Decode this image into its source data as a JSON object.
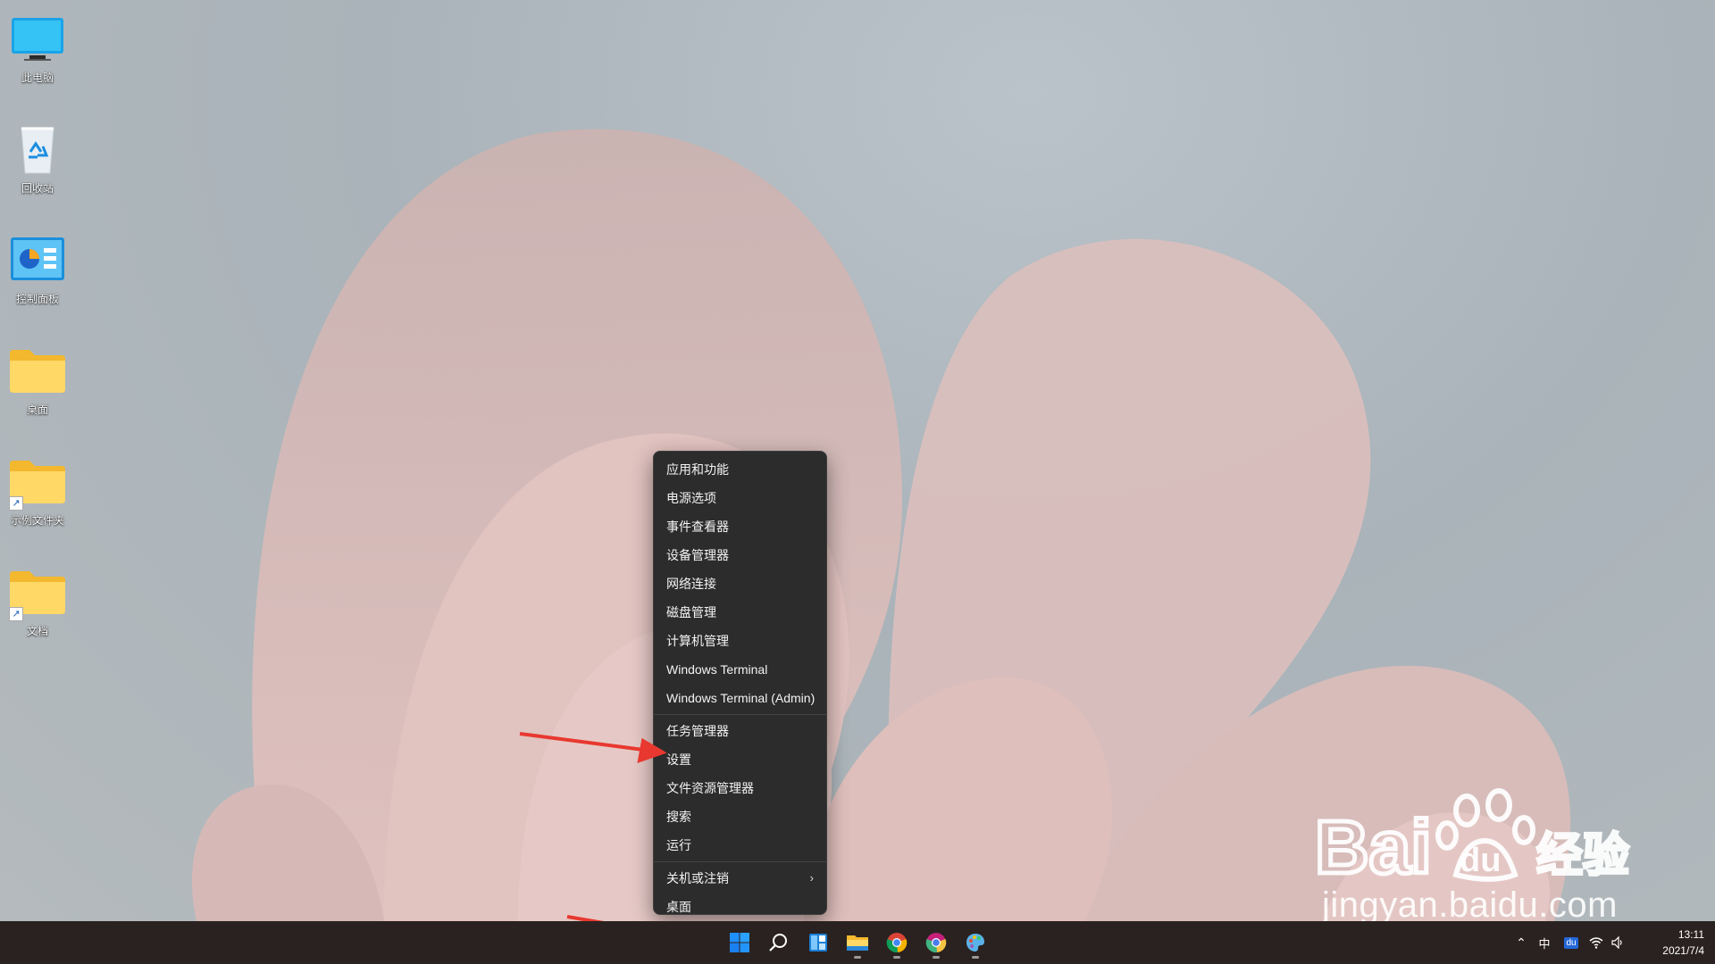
{
  "desktop": {
    "icons": [
      {
        "label": "此电脑",
        "icon": "computer-icon"
      },
      {
        "label": "回收站",
        "icon": "recycle-bin-icon"
      },
      {
        "label": "控制面板",
        "icon": "control-panel-icon"
      },
      {
        "label": "桌面",
        "icon": "folder-icon"
      },
      {
        "label": "示例文件夹",
        "icon": "folder-shortcut-icon"
      },
      {
        "label": "文档",
        "icon": "folder-shortcut-icon"
      }
    ]
  },
  "context_menu": {
    "items": [
      "应用和功能",
      "电源选项",
      "事件查看器",
      "设备管理器",
      "网络连接",
      "磁盘管理",
      "计算机管理",
      "Windows Terminal",
      "Windows Terminal (Admin)",
      "任务管理器",
      "设置",
      "文件资源管理器",
      "搜索",
      "运行",
      "关机或注销",
      "桌面"
    ]
  },
  "taskbar": {
    "apps": [
      "start-icon",
      "search-icon",
      "widgets-icon",
      "file-explorer-icon",
      "chrome-icon",
      "chrome-canary-icon",
      "paint-icon"
    ],
    "tray": {
      "ime": "中",
      "baidu_badge": "du"
    },
    "clock": {
      "time": "13:11",
      "date": "2021/7/4"
    }
  },
  "watermark": {
    "brand": "Bai du 经验",
    "url": "jingyan.baidu.com"
  },
  "colors": {
    "menu_bg": "#2c2c2c",
    "taskbar_bg": "#2a2220",
    "annotation_arrow": "#e8382f",
    "start_blue": "#1f8fff"
  }
}
